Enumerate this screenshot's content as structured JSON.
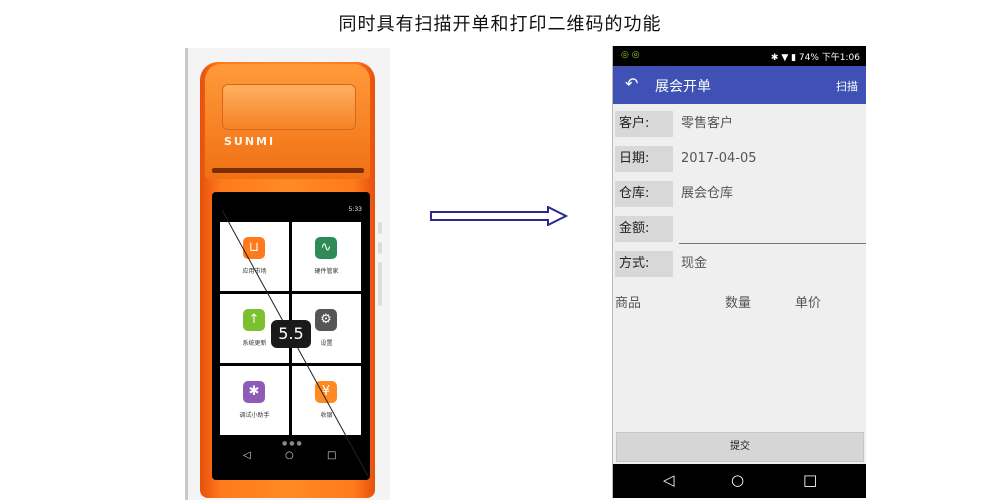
{
  "caption": "同时具有扫描开单和打印二维码的功能",
  "device": {
    "brand": "SUNMI",
    "status_time": "5:33",
    "size_label": "5.5",
    "apps": [
      {
        "label": "应用市场",
        "icon": "shopping-bag-icon",
        "color": "#ff7a1a"
      },
      {
        "label": "硬件管家",
        "icon": "pulse-monitor-icon",
        "color": "#2e8b57"
      },
      {
        "label": "系统更新",
        "icon": "update-arrow-icon",
        "color": "#7cbf2f"
      },
      {
        "label": "设置",
        "icon": "gear-icon",
        "color": "#555555"
      },
      {
        "label": "调试小助手",
        "icon": "bug-icon",
        "color": "#8e5bb8"
      },
      {
        "label": "收银",
        "icon": "yen-icon",
        "color": "#ff8a24"
      }
    ],
    "nav": {
      "back": "◁",
      "home": "○",
      "recent": "□"
    }
  },
  "phone": {
    "status": {
      "left_icons": "◎ ◎",
      "right": "✱ ▼ ▮ 74% 下午1:06"
    },
    "appbar": {
      "title": "展会开单",
      "action": "扫描",
      "back_icon": "↶"
    },
    "fields": [
      {
        "label": "客户:",
        "value": "零售客户"
      },
      {
        "label": "日期:",
        "value": "2017-04-05"
      },
      {
        "label": "仓库:",
        "value": "展会仓库"
      },
      {
        "label": "金额:",
        "value": ""
      },
      {
        "label": "方式:",
        "value": "现金"
      }
    ],
    "table_headers": [
      "商品",
      "数量",
      "单价"
    ],
    "submit_label": "提交",
    "nav": {
      "back": "◁",
      "home": "○",
      "recent": "□"
    }
  },
  "colors": {
    "appbar": "#3f51b5",
    "device": "#ff7a1a",
    "arrow": "#2a2a8c"
  }
}
